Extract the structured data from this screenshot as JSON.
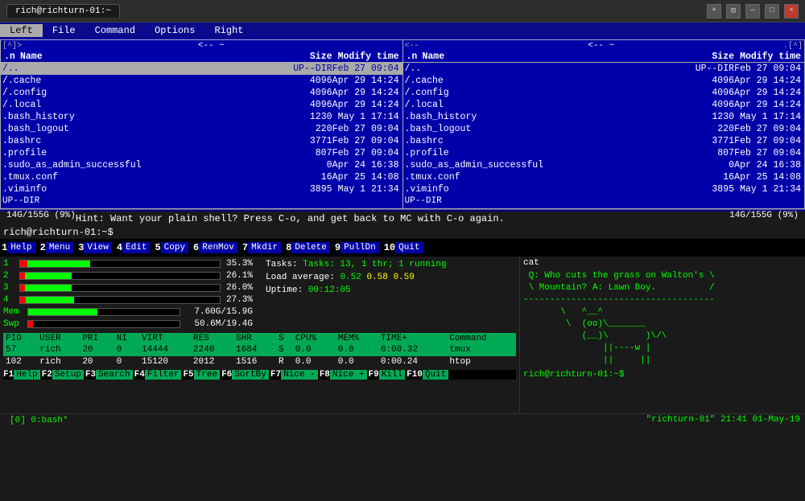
{
  "titlebar": {
    "title": "rich@richturn-01:~",
    "tab_active": "rich@richturn-01:~",
    "tab_close": "×",
    "btn_new": "+",
    "btn_min": "—",
    "btn_max": "□",
    "btn_close": "×"
  },
  "menubar": {
    "items": [
      "Left",
      "File",
      "Command",
      "Options",
      "Right"
    ]
  },
  "left_panel": {
    "path_indicator": "<-- ~",
    "corner": ".[^]>",
    "col_n": ".n",
    "col_name": "Name",
    "col_size": "Size",
    "col_modify": "Modify time",
    "rows": [
      {
        "name": "/..",
        "size": "UP--DIR",
        "modify": "Feb 27 09:04",
        "selected": true
      },
      {
        "name": "/.cache",
        "size": "4096",
        "modify": "Apr 29 14:24"
      },
      {
        "name": "/.config",
        "size": "4096",
        "modify": "Apr 29 14:24"
      },
      {
        "name": "/.local",
        "size": "4096",
        "modify": "Apr 29 14:24"
      },
      {
        "name": ".bash_history",
        "size": "1230",
        "modify": "May  1 17:14"
      },
      {
        "name": ".bash_logout",
        "size": "220",
        "modify": "Feb 27 09:04"
      },
      {
        "name": ".bashrc",
        "size": "3771",
        "modify": "Feb 27 09:04"
      },
      {
        "name": ".profile",
        "size": "807",
        "modify": "Feb 27 09:04"
      },
      {
        "name": ".sudo_as_admin_successful",
        "size": "0",
        "modify": "Apr 24 16:38"
      },
      {
        "name": ".tmux.conf",
        "size": "16",
        "modify": "Apr 25 14:08"
      },
      {
        "name": ".viminfo",
        "size": "3895",
        "modify": "May  1 21:34"
      }
    ],
    "status": "UP--DIR",
    "disk_info": "14G/155G (9%)"
  },
  "right_panel": {
    "path_indicator": "<-- ~",
    "corner": ".[^]",
    "col_n": ".n",
    "col_name": "Name",
    "col_size": "Size",
    "col_modify": "Modify time",
    "rows": [
      {
        "name": "/..",
        "size": "UP--DIR",
        "modify": "Feb 27 09:04"
      },
      {
        "name": "/.cache",
        "size": "4096",
        "modify": "Apr 29 14:24"
      },
      {
        "name": "/.config",
        "size": "4096",
        "modify": "Apr 29 14:24"
      },
      {
        "name": "/.local",
        "size": "4096",
        "modify": "Apr 29 14:24"
      },
      {
        "name": ".bash_history",
        "size": "1230",
        "modify": "May  1 17:14"
      },
      {
        "name": ".bash_logout",
        "size": "220",
        "modify": "Feb 27 09:04"
      },
      {
        "name": ".bashrc",
        "size": "3771",
        "modify": "Feb 27 09:04"
      },
      {
        "name": ".profile",
        "size": "807",
        "modify": "Feb 27 09:04"
      },
      {
        "name": ".sudo_as_admin_successful",
        "size": "0",
        "modify": "Apr 24 16:38"
      },
      {
        "name": ".tmux.conf",
        "size": "16",
        "modify": "Apr 25 14:08"
      },
      {
        "name": ".viminfo",
        "size": "3895",
        "modify": "May  1 21:34"
      }
    ],
    "status": "UP--DIR",
    "disk_info": "14G/155G (9%)"
  },
  "hint_line": "Hint: Want your plain shell? Press C-o, and get back to MC with C-o again.",
  "prompt_line": "rich@richturn-01:~$",
  "fkeys": [
    {
      "num": "1",
      "label": "Help"
    },
    {
      "num": "2",
      "label": "Menu"
    },
    {
      "num": "3",
      "label": "View"
    },
    {
      "num": "4",
      "label": "Edit"
    },
    {
      "num": "5",
      "label": "Copy"
    },
    {
      "num": "6",
      "label": "RenMov"
    },
    {
      "num": "7",
      "label": "Mkdir"
    },
    {
      "num": "8",
      "label": "Delete"
    },
    {
      "num": "9",
      "label": "PullDn"
    },
    {
      "num": "10",
      "label": "Quit"
    }
  ],
  "htop": {
    "cpu_rows": [
      {
        "label": "1",
        "percent": "35.3%",
        "bar_pct": 35
      },
      {
        "label": "2",
        "percent": "26.1%",
        "bar_pct": 26
      },
      {
        "label": "3",
        "percent": "26.0%",
        "bar_pct": 26
      },
      {
        "label": "4",
        "percent": "27.3%",
        "bar_pct": 27
      }
    ],
    "mem_label": "Mem",
    "mem_bar_pct": 46,
    "mem_val": "7.60G/15.9G",
    "swp_label": "Swp",
    "swp_bar_pct": 3,
    "swp_val": "50.6M/19.4G",
    "tasks_line": "Tasks: 13, 1 thr; 1 running",
    "load_label": "Load average:",
    "load_values": "0.52  0.58  0.59",
    "uptime_label": "Uptime:",
    "uptime_val": "00:12:05",
    "process_headers": [
      "PID",
      "USER",
      "PRI",
      "NI",
      "VIRT",
      "RES",
      "SHR",
      "S",
      "CPU%",
      "MEM%",
      "TIME+",
      "Command"
    ],
    "process_rows": [
      {
        "pid": "57",
        "user": "rich",
        "pri": "20",
        "ni": "0",
        "virt": "14444",
        "res": "2240",
        "shr": "1684",
        "s": "S",
        "cpu": "0.0",
        "mem": "0.0",
        "time": "0:00.32",
        "cmd": "tmux",
        "highlighted": true
      },
      {
        "pid": "102",
        "user": "rich",
        "pri": "20",
        "ni": "0",
        "virt": "15120",
        "res": "2012",
        "shr": "1516",
        "s": "R",
        "cpu": "0.0",
        "mem": "0.0",
        "time": "0:00.24",
        "cmd": "htop",
        "highlighted": false
      }
    ]
  },
  "cat_pane": {
    "title": "cat",
    "text": " Q: Who cuts the grass on Walton's \\\n \\ Mountain? A: Lawn Boy.          /\n------------------------------------\n       \\   ^__^\n        \\  (oo)\\_______\n           (__)\\       )\\/\\\n               ||----w |\n               ||     ||",
    "prompt": "rich@richturn-01:~$"
  },
  "status_bar": {
    "text": "\"richturn-01\" 21:41 01-May-19"
  },
  "bottom_fkeys": [
    {
      "num": "F1",
      "label": "Help"
    },
    {
      "num": "F2",
      "label": "Setup"
    },
    {
      "num": "F3",
      "label": "Search"
    },
    {
      "num": "F4",
      "label": "Filter"
    },
    {
      "num": "F5",
      "label": "Tree"
    },
    {
      "num": "F6",
      "label": "SortBy"
    },
    {
      "num": "F7",
      "label": "Nice -"
    },
    {
      "num": "F8",
      "label": "Nice +"
    },
    {
      "num": "F9",
      "label": "Kill"
    },
    {
      "num": "F10",
      "label": "Quit"
    }
  ],
  "tab_indicator": "[0] 0:bash*"
}
